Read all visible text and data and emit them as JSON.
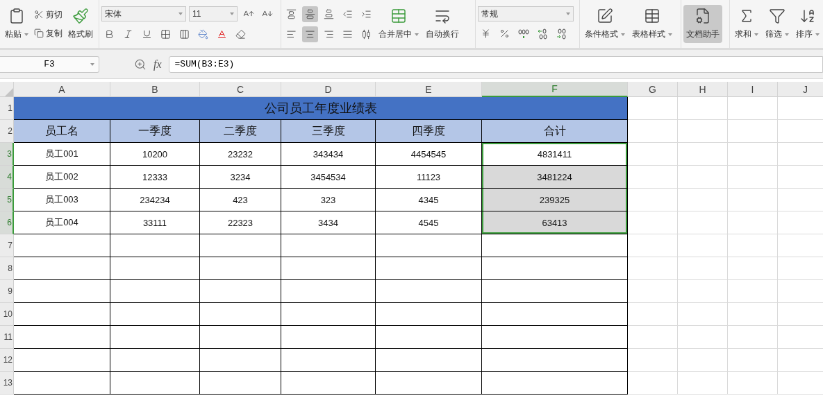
{
  "ribbon": {
    "clipboard": {
      "paste": "粘贴",
      "cut": "剪切",
      "copy": "复制",
      "format_painter": "格式刷"
    },
    "font": {
      "name": "宋体",
      "size": "11"
    },
    "alignment": [
      {
        "selected": false
      },
      {
        "selected": true
      },
      {
        "selected": false
      },
      {
        "selected": false
      },
      {
        "selected": false
      },
      {
        "selected": false
      },
      {
        "selected": true
      },
      {
        "selected": false
      },
      {
        "selected": false
      },
      {
        "selected": false
      }
    ],
    "merge": "合并居中",
    "wrap": "自动换行",
    "number_format": "常规",
    "styles": [
      {
        "label": "条件格式",
        "kind": "conditional"
      },
      {
        "label": "表格样式",
        "kind": "table"
      }
    ],
    "assistant": {
      "label": "文档助手",
      "selected": true
    },
    "tools": [
      {
        "label": "求和",
        "kind": "sum"
      },
      {
        "label": "筛选",
        "kind": "filter"
      },
      {
        "label": "排序",
        "kind": "sort"
      }
    ]
  },
  "formula_bar": {
    "cell": "F3",
    "function_label": "fx",
    "formula": "=SUM(B3:E3)"
  },
  "columns": [
    {
      "label": "A",
      "selected": false
    },
    {
      "label": "B",
      "selected": false
    },
    {
      "label": "C",
      "selected": false
    },
    {
      "label": "D",
      "selected": false
    },
    {
      "label": "E",
      "selected": false
    },
    {
      "label": "F",
      "selected": true
    },
    {
      "label": "G",
      "selected": false
    },
    {
      "label": "H",
      "selected": false
    },
    {
      "label": "I",
      "selected": false
    },
    {
      "label": "J",
      "selected": false
    }
  ],
  "row_headers": [
    {
      "label": "1",
      "selected": false
    },
    {
      "label": "2",
      "selected": false
    },
    {
      "label": "3",
      "selected": true
    },
    {
      "label": "4",
      "selected": true
    },
    {
      "label": "5",
      "selected": true
    },
    {
      "label": "6",
      "selected": true
    },
    {
      "label": "7",
      "selected": false
    },
    {
      "label": "8",
      "selected": false
    },
    {
      "label": "9",
      "selected": false
    },
    {
      "label": "10",
      "selected": false
    },
    {
      "label": "11",
      "selected": false
    },
    {
      "label": "12",
      "selected": false
    },
    {
      "label": "13",
      "selected": false
    }
  ],
  "sheet": {
    "title": "公司员工年度业绩表",
    "header": [
      "员工名",
      "一季度",
      "二季度",
      "三季度",
      "四季度",
      "合计"
    ],
    "rows": [
      [
        {
          "text": "员工001",
          "selected": false
        },
        {
          "text": "10200",
          "selected": false
        },
        {
          "text": "23232",
          "selected": false
        },
        {
          "text": "343434",
          "selected": false
        },
        {
          "text": "4454545",
          "selected": false
        },
        {
          "text": "4831411",
          "selected": true
        }
      ],
      [
        {
          "text": "员工002",
          "selected": false
        },
        {
          "text": "12333",
          "selected": false
        },
        {
          "text": "3234",
          "selected": false
        },
        {
          "text": "3454534",
          "selected": false
        },
        {
          "text": "11123",
          "selected": false
        },
        {
          "text": "3481224",
          "selected": true
        }
      ],
      [
        {
          "text": "员工003",
          "selected": false
        },
        {
          "text": "234234",
          "selected": false
        },
        {
          "text": "423",
          "selected": false
        },
        {
          "text": "323",
          "selected": false
        },
        {
          "text": "4345",
          "selected": false
        },
        {
          "text": "239325",
          "selected": true
        }
      ],
      [
        {
          "text": "员工004",
          "selected": false
        },
        {
          "text": "33111",
          "selected": false
        },
        {
          "text": "22323",
          "selected": false
        },
        {
          "text": "3434",
          "selected": false
        },
        {
          "text": "4545",
          "selected": false
        },
        {
          "text": "63413",
          "selected": true
        }
      ]
    ]
  }
}
